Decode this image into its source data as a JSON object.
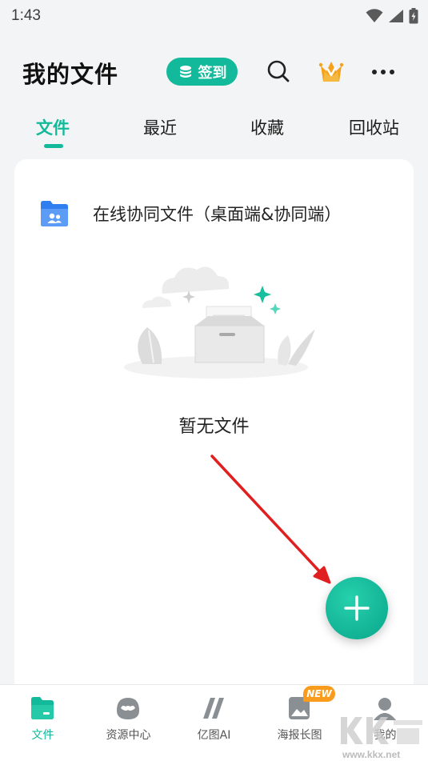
{
  "status_bar": {
    "time": "1:43"
  },
  "header": {
    "title": "我的文件",
    "sign_in_label": "签到",
    "icons": [
      "search-icon",
      "vip-crown-icon",
      "more-icon"
    ]
  },
  "tabs": [
    {
      "label": "文件",
      "active": true
    },
    {
      "label": "最近",
      "active": false
    },
    {
      "label": "收藏",
      "active": false
    },
    {
      "label": "回收站",
      "active": false
    }
  ],
  "content": {
    "online_folder_label": "在线协同文件（桌面端&协同端）",
    "empty_text": "暂无文件"
  },
  "bottom_nav": [
    {
      "label": "文件",
      "icon": "file-icon",
      "active": true
    },
    {
      "label": "资源中心",
      "icon": "resource-center-icon",
      "active": false
    },
    {
      "label": "亿图AI",
      "icon": "edraw-ai-icon",
      "active": false
    },
    {
      "label": "海报长图",
      "icon": "poster-icon",
      "active": false,
      "badge": "NEW"
    },
    {
      "label": "我的",
      "icon": "profile-icon",
      "active": false
    }
  ],
  "watermark": {
    "url": "www.kkx.net"
  },
  "colors": {
    "accent": "#12b99a",
    "badge": "#f99b1c",
    "arrow": "#e02020"
  }
}
